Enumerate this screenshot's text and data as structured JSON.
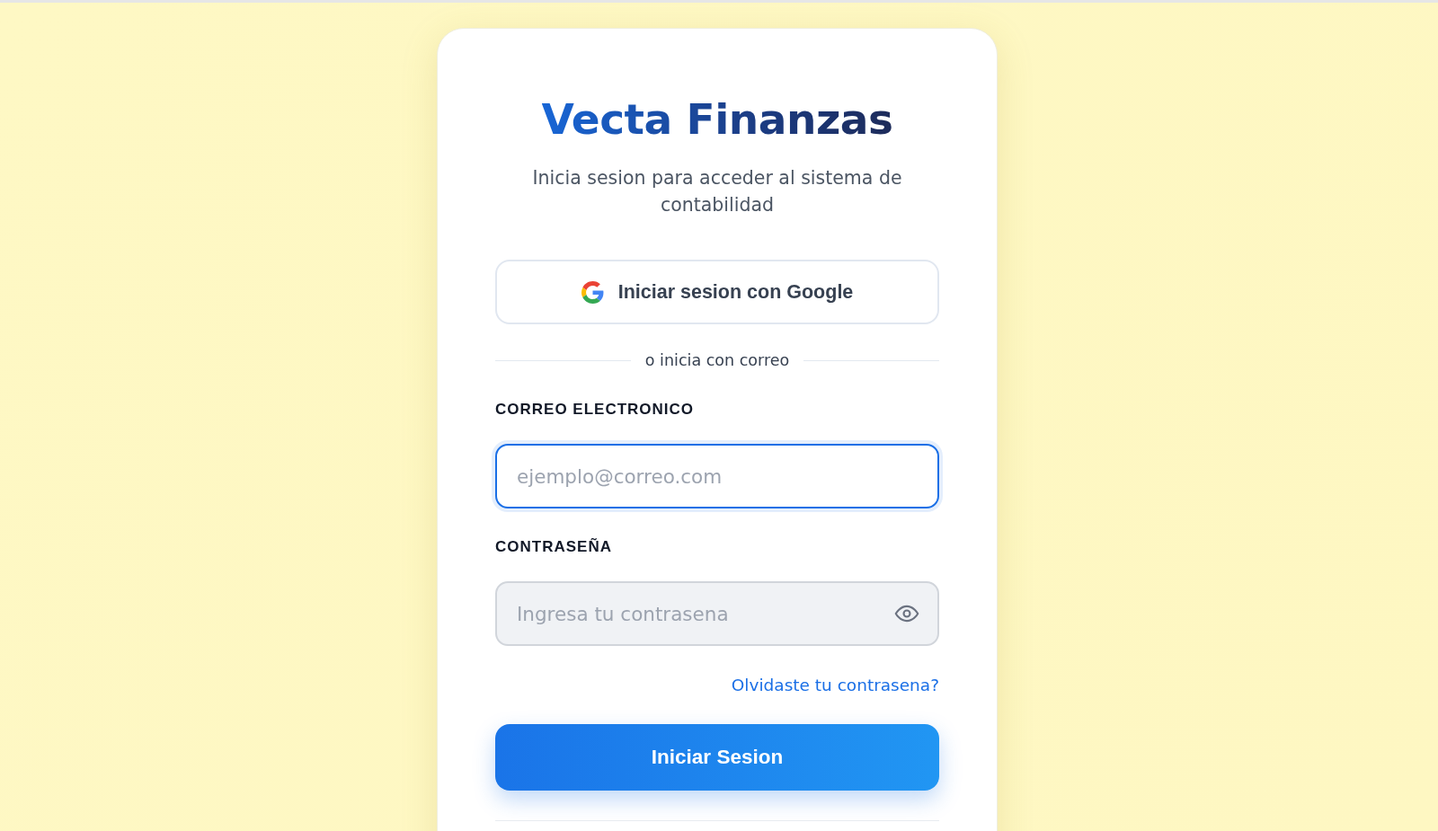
{
  "brand": {
    "title": "Vecta Finanzas",
    "subtitle": "Inicia sesion para acceder al sistema de contabilidad"
  },
  "google_button": {
    "label": "Iniciar sesion con Google"
  },
  "divider": {
    "label": "o inicia con correo"
  },
  "fields": [
    {
      "kind": "email",
      "label": "CORREO ELECTRONICO",
      "placeholder": "ejemplo@correo.com",
      "focused": true
    },
    {
      "kind": "password",
      "label": "CONTRASEÑA",
      "placeholder": "Ingresa tu contrasena",
      "focused": false
    }
  ],
  "forgot_link": {
    "label": "Olvidaste tu contrasena?"
  },
  "submit_button": {
    "label": "Iniciar Sesion"
  }
}
